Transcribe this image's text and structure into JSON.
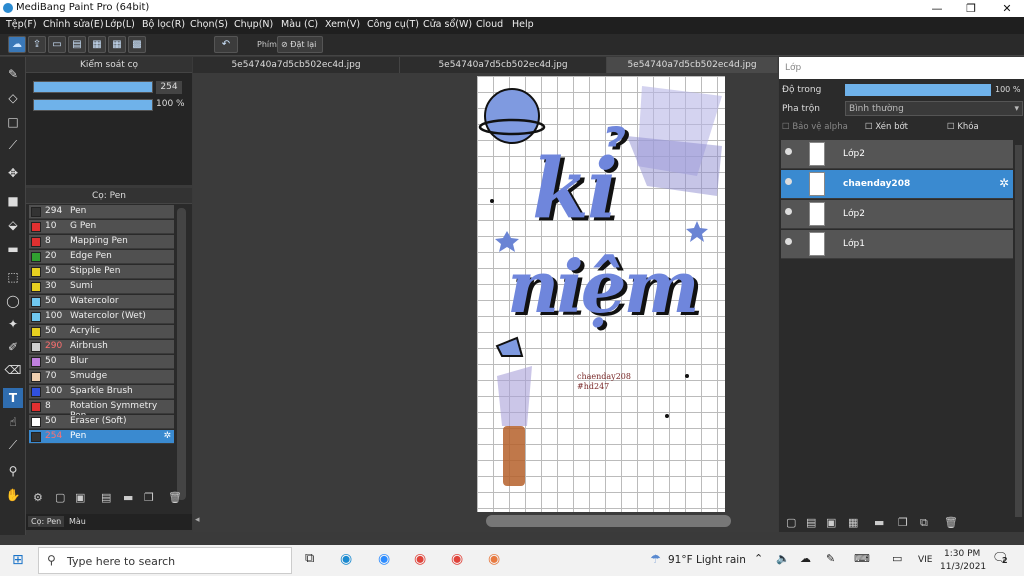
{
  "window": {
    "title": "MediBang Paint Pro (64bit)",
    "min": "—",
    "max": "❐",
    "close": "✕"
  },
  "menu": [
    "Tệp(F)",
    "Chỉnh sửa(E)",
    "Lớp(L)",
    "Bộ lọc(R)",
    "Chọn(S)",
    "Chụp(N)",
    "Màu (C)",
    "Xem(V)",
    "Công cụ(T)",
    "Cửa sổ(W)",
    "Cloud",
    "Help"
  ],
  "toolbar": {
    "phim": "Phím",
    "reset": "Đặt lại"
  },
  "control": {
    "title": "Kiểm soát cọ",
    "size": "254",
    "opacity": "100 %",
    "size_frac": 1.0,
    "opacity_frac": 1.0
  },
  "brushes": {
    "title": "Cọ: Pen",
    "items": [
      {
        "n": "294",
        "l": "Pen",
        "c": "#333333"
      },
      {
        "n": "10",
        "l": "G Pen",
        "c": "#e03030"
      },
      {
        "n": "8",
        "l": "Mapping Pen",
        "c": "#e03030"
      },
      {
        "n": "20",
        "l": "Edge Pen",
        "c": "#30a030"
      },
      {
        "n": "50",
        "l": "Stipple Pen",
        "c": "#e8d020"
      },
      {
        "n": "30",
        "l": "Sumi",
        "c": "#e8d020"
      },
      {
        "n": "50",
        "l": "Watercolor",
        "c": "#70c8f0"
      },
      {
        "n": "100",
        "l": "Watercolor (Wet)",
        "c": "#70c8f0"
      },
      {
        "n": "50",
        "l": "Acrylic",
        "c": "#e8d020"
      },
      {
        "n": "290",
        "l": "Airbrush",
        "c": "#d0d0d0"
      },
      {
        "n": "50",
        "l": "Blur",
        "c": "#c080e0"
      },
      {
        "n": "70",
        "l": "Smudge",
        "c": "#f0d0b0"
      },
      {
        "n": "100",
        "l": "Sparkle Brush",
        "c": "#3050e0"
      },
      {
        "n": "8",
        "l": "Rotation Symmetry Pen",
        "c": "#e03030"
      },
      {
        "n": "50",
        "l": "Eraser (Soft)",
        "c": "#ffffff"
      },
      {
        "n": "254",
        "l": "Pen",
        "c": "#333333"
      }
    ],
    "tab1": "Cọ: Pen",
    "tab2": "Màu"
  },
  "tabs": [
    "5e54740a7d5cb502ec4d.jpg",
    "5e54740a7d5cb502ec4d.jpg",
    "5e54740a7d5cb502ec4d.jpg"
  ],
  "artwork": {
    "line1": "kỉ",
    "line2": "niệm",
    "credit1": "chaenday208",
    "credit2": "#hd247"
  },
  "layers": {
    "title": "Lớp",
    "opacity_label": "Độ trong",
    "opacity": "100 %",
    "blend_label": "Pha trộn",
    "blend": "Bình thường",
    "protect": "Bảo vệ alpha",
    "clip": "Xén bớt",
    "lock": "Khóa",
    "items": [
      {
        "name": "Lớp2",
        "sel": false
      },
      {
        "name": "chaenday208",
        "sel": true
      },
      {
        "name": "Lớp2",
        "sel": false
      },
      {
        "name": "Lớp1",
        "sel": false
      }
    ]
  },
  "taskbar": {
    "search": "Type here to search",
    "weather": "91°F  Light rain",
    "lang": "VIE",
    "time": "1:30 PM",
    "date": "11/3/2021",
    "notif": "2"
  }
}
